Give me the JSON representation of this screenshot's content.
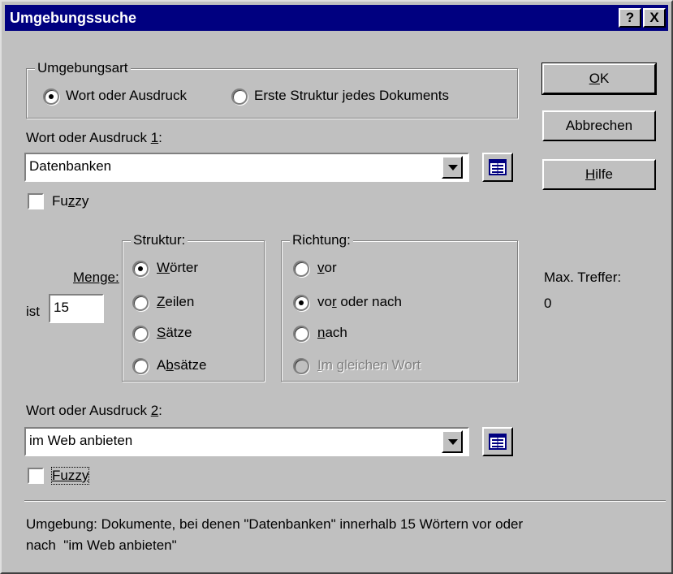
{
  "window": {
    "title": "Umgebungssuche",
    "help_button": "?",
    "close_button": "X"
  },
  "umgebungsart": {
    "group_title": "Umgebungsart",
    "option1": "Wort oder Ausdruck",
    "option2": "Erste Struktur jedes Dokuments",
    "selected": "Wort oder Ausdruck"
  },
  "word1": {
    "label_prefix": "Wort oder Ausdruck ",
    "label_key": "1",
    "label_suffix": ":",
    "value": "Datenbanken",
    "fuzzy_prefix": "Fu",
    "fuzzy_key": "z",
    "fuzzy_suffix": "zy",
    "fuzzy_checked": false
  },
  "menge": {
    "label": "Menge:",
    "prefix": "ist",
    "value": "15"
  },
  "struktur": {
    "title": "Struktur:",
    "items": [
      {
        "pre": "",
        "key": "W",
        "post": "örter",
        "checked": true
      },
      {
        "pre": "",
        "key": "Z",
        "post": "eilen",
        "checked": false
      },
      {
        "pre": "",
        "key": "S",
        "post": "ätze",
        "checked": false
      },
      {
        "pre": "A",
        "key": "b",
        "post": "sätze",
        "checked": false
      }
    ]
  },
  "richtung": {
    "title": "Richtung:",
    "items": [
      {
        "pre": "",
        "key": "v",
        "post": "or",
        "checked": true
      },
      {
        "pre": "vo",
        "key": "r",
        "post": " oder nach",
        "checked": true
      },
      {
        "pre": "",
        "key": "n",
        "post": "ach",
        "checked": false
      },
      {
        "pre": "",
        "key": "I",
        "post": "m gleichen Wort",
        "checked": false,
        "disabled": true
      }
    ]
  },
  "max_treffer": {
    "label": "Max. Treffer:",
    "value": "0"
  },
  "word2": {
    "label_prefix": "Wort oder Ausdruck ",
    "label_key": "2",
    "label_suffix": ":",
    "value": "im Web anbieten",
    "fuzzy_label": "Fuzzy",
    "fuzzy_checked": false
  },
  "buttons": {
    "ok_key": "O",
    "ok_rest": "K",
    "cancel": "Abbrechen",
    "help_key": "H",
    "help_rest": "ilfe"
  },
  "summary": {
    "line1": "Umgebung: Dokumente, bei denen \"Datenbanken\" innerhalb 15 Wörtern vor oder",
    "line2": "nach  \"im Web anbieten\""
  },
  "colors": {
    "titlebar": "#000080",
    "face": "#c0c0c0"
  }
}
